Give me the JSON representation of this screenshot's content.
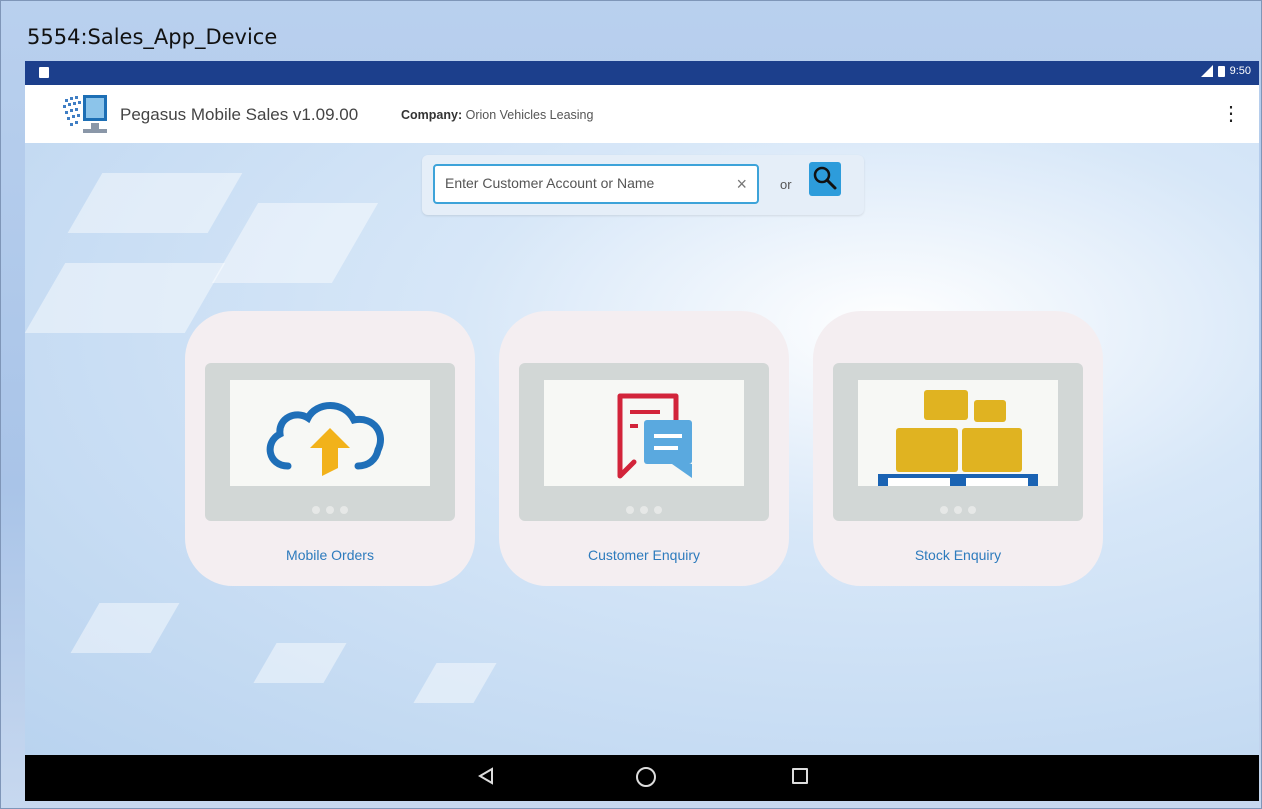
{
  "window": {
    "title": "5554:Sales_App_Device"
  },
  "status_bar": {
    "time": "9:50"
  },
  "app_bar": {
    "app_name": "Pegasus Mobile Sales v1.09.00",
    "company_label": "Company:",
    "company_name": "Orion Vehicles Leasing",
    "overflow_icon": "more-vert-icon"
  },
  "search": {
    "placeholder": "Enter Customer Account or Name",
    "value": "",
    "clear_glyph": "×",
    "or_label": "or",
    "search_icon": "search-icon"
  },
  "tiles": [
    {
      "label": "Mobile Orders",
      "icon": "cloud-upload-icon"
    },
    {
      "label": "Customer Enquiry",
      "icon": "chat-document-icon"
    },
    {
      "label": "Stock Enquiry",
      "icon": "pallet-boxes-icon"
    }
  ],
  "colors": {
    "status_bar": "#1c3f8c",
    "accent": "#2d9cdb",
    "tile_label": "#2d7bbd",
    "cloud_blue": "#1f6fb8",
    "arrow_yellow": "#f2b21a",
    "enquiry_red": "#d2243a",
    "enquiry_blue": "#5aa9df",
    "box_yellow": "#e0b321",
    "pallet_blue": "#1a63b3"
  }
}
